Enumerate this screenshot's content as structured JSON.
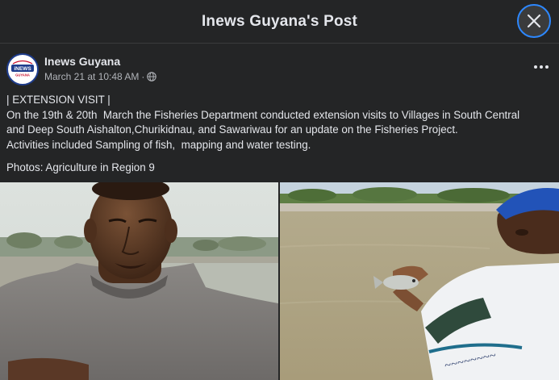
{
  "header": {
    "title": "Inews Guyana's Post"
  },
  "post": {
    "page_name": "Inews Guyana",
    "avatar_text": "iNEWS",
    "avatar_subtext": "GUYANA",
    "timestamp": "March 21 at 10:48 AM",
    "separator": "·",
    "audience_icon": "globe-icon",
    "lines": [
      "| EXTENSION VISIT |",
      "On the 19th & 20th  March the Fisheries Department conducted extension visits to Villages in South Central",
      "and Deep South Aishalton,Churikidnau, and Sawariwau for an update on the Fisheries Project.",
      "Activities included Sampling of fish,  mapping and water testing."
    ],
    "credit": "Photos: Agriculture in Region 9"
  },
  "colors": {
    "background": "#242526",
    "accent": "#2d88ff",
    "text": "#e4e6eb",
    "secondary": "#b0b3b8"
  }
}
